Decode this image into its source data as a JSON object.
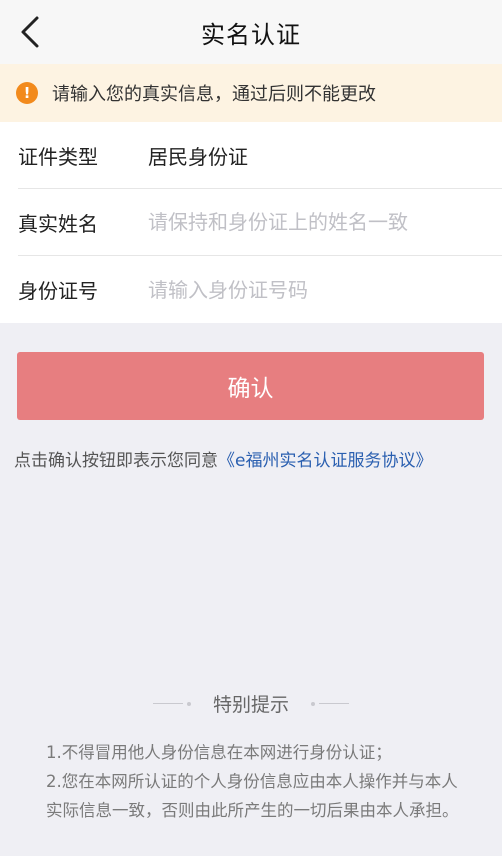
{
  "navbar": {
    "back_icon": "chevron-left-icon",
    "title": "实名认证"
  },
  "notice": {
    "icon": "exclamation-circle-icon",
    "icon_glyph": "!",
    "icon_color": "#f28a1c",
    "text": "请输入您的真实信息，通过后则不能更改"
  },
  "form": {
    "id_type": {
      "label": "证件类型",
      "value": "居民身份证"
    },
    "real_name": {
      "label": "真实姓名",
      "value": "",
      "placeholder": "请保持和身份证上的姓名一致"
    },
    "id_number": {
      "label": "身份证号",
      "value": "",
      "placeholder": "请输入身份证号码"
    }
  },
  "confirm": {
    "label": "确认",
    "color": "#e77e80"
  },
  "agreement": {
    "prefix": "点击确认按钮即表示您同意",
    "link": "《e福州实名认证服务协议》",
    "link_color": "#2a5fb0"
  },
  "tips": {
    "title": "特别提示",
    "lines": [
      "1.不得冒用他人身份信息在本网进行身份认证；",
      "2.您在本网所认证的个人身份信息应由本人操作并与本人实际信息一致，否则由此所产生的一切后果由本人承担。"
    ]
  }
}
